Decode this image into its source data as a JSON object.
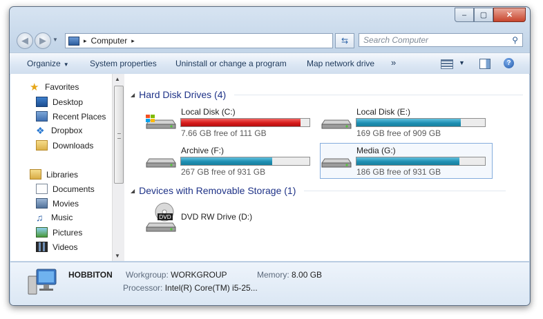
{
  "window": {
    "minimize": "–",
    "maximize": "▢",
    "close": "✕"
  },
  "address": {
    "path": [
      "Computer"
    ],
    "separator": "▸"
  },
  "search": {
    "placeholder": "Search Computer"
  },
  "toolbar": {
    "organize": "Organize",
    "system_properties": "System properties",
    "uninstall": "Uninstall or change a program",
    "map_network": "Map network drive",
    "more": "»"
  },
  "nav": {
    "favorites": {
      "label": "Favorites",
      "items": [
        "Desktop",
        "Recent Places",
        "Dropbox",
        "Downloads"
      ]
    },
    "libraries": {
      "label": "Libraries",
      "items": [
        "Documents",
        "Movies",
        "Music",
        "Pictures",
        "Videos"
      ]
    }
  },
  "groups": {
    "hard_disks": {
      "title": "Hard Disk Drives (4)"
    },
    "removable": {
      "title": "Devices with Removable Storage (1)"
    }
  },
  "drives": [
    {
      "name": "Local Disk (C:)",
      "free": "7.66 GB free of 111 GB",
      "used_fraction": 0.93,
      "color": "#d61b1b"
    },
    {
      "name": "Local Disk (E:)",
      "free": "169 GB free of 909 GB",
      "used_fraction": 0.81,
      "color": "#1f8fb3"
    },
    {
      "name": "Archive (F:)",
      "free": "267 GB free of 931 GB",
      "used_fraction": 0.71,
      "color": "#1f8fb3"
    },
    {
      "name": "Media (G:)",
      "free": "186 GB free of 931 GB",
      "used_fraction": 0.8,
      "color": "#1f8fb3",
      "selected": true
    }
  ],
  "removable": [
    {
      "name": "DVD RW Drive (D:)",
      "badge": "DVD"
    }
  ],
  "details": {
    "computer_name": "HOBBITON",
    "workgroup_label": "Workgroup:",
    "workgroup": "WORKGROUP",
    "memory_label": "Memory:",
    "memory": "8.00 GB",
    "processor_label": "Processor:",
    "processor": "Intel(R) Core(TM) i5-25..."
  }
}
